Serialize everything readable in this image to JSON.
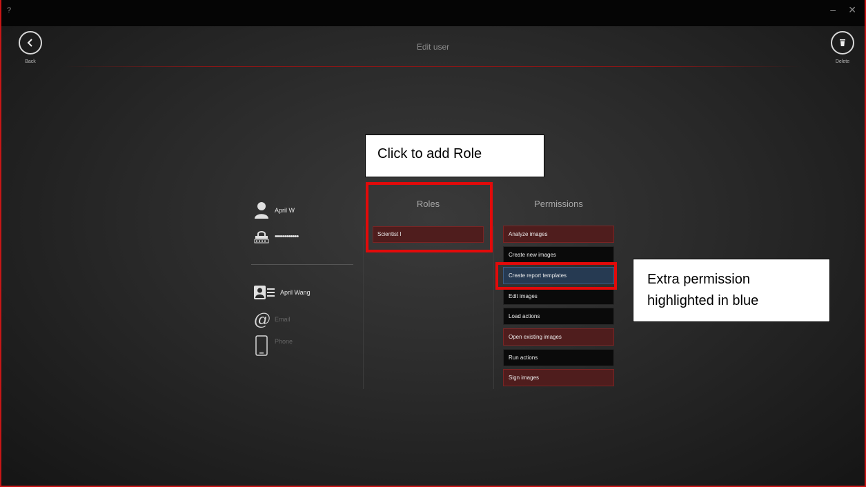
{
  "titlebar": {
    "help": "?",
    "minimize": "–",
    "close": "✕"
  },
  "header": {
    "title": "Edit user",
    "back_label": "Back",
    "delete_label": "Delete",
    "accent_color": "#c81616"
  },
  "profile": {
    "username": "April W",
    "password": "••••••••••••",
    "full_name": "April Wang",
    "email_placeholder": "Email",
    "phone_placeholder": "Phone"
  },
  "roles": {
    "heading": "Roles",
    "items": [
      {
        "label": "Scientist I",
        "style": "red"
      }
    ]
  },
  "permissions": {
    "heading": "Permissions",
    "items": [
      {
        "label": "Analyze images",
        "style": "red"
      },
      {
        "label": "Create new images",
        "style": "black"
      },
      {
        "label": "Create report templates",
        "style": "blue"
      },
      {
        "label": "Edit images",
        "style": "black"
      },
      {
        "label": "Load actions",
        "style": "black"
      },
      {
        "label": "Open existing images",
        "style": "red"
      },
      {
        "label": "Run actions",
        "style": "black"
      },
      {
        "label": "Sign images",
        "style": "red"
      }
    ]
  },
  "annotations": {
    "add_role": "Click to add Role",
    "extra_permission_line1": "Extra permission",
    "extra_permission_line2": "highlighted in blue"
  }
}
